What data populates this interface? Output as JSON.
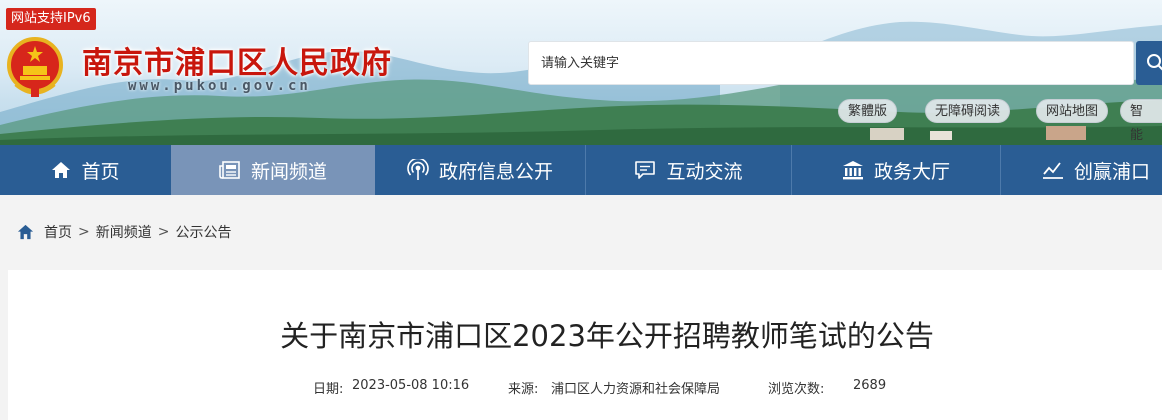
{
  "header": {
    "ipv6_badge": "网站支持IPv6",
    "site_title": "南京市浦口区人民政府",
    "site_url": "www.pukou.gov.cn",
    "search_placeholder": "请输入关键字",
    "tools": [
      "繁體版",
      "无障碍阅读",
      "网站地图",
      "智能"
    ]
  },
  "nav": {
    "items": [
      {
        "label": "首页",
        "icon": "home-icon"
      },
      {
        "label": "新闻频道",
        "icon": "newspaper-icon",
        "active": true
      },
      {
        "label": "政府信息公开",
        "icon": "broadcast-icon"
      },
      {
        "label": "互动交流",
        "icon": "chat-icon"
      },
      {
        "label": "政务大厅",
        "icon": "building-icon"
      },
      {
        "label": "创赢浦口",
        "icon": "chart-icon"
      }
    ]
  },
  "breadcrumb": {
    "items": [
      "首页",
      "新闻频道",
      "公示公告"
    ],
    "separator": ">"
  },
  "article": {
    "title": "关于南京市浦口区2023年公开招聘教师笔试的公告",
    "date_label": "日期:",
    "date": "2023-05-08 10:16",
    "source_label": "来源:",
    "source": "浦口区人力资源和社会保障局",
    "views_label": "浏览次数:",
    "views": "2689"
  },
  "colors": {
    "nav_bg": "#2a5d94",
    "nav_active": "#7994b8",
    "title_red": "#c8160c",
    "breadcrumb_icon": "#2a5d94"
  }
}
